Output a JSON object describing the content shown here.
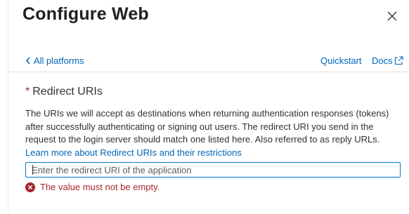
{
  "header": {
    "title": "Configure Web",
    "close_icon": "close-icon"
  },
  "nav": {
    "back_label": "All platforms",
    "back_icon": "chevron-left-icon",
    "quickstart_label": "Quickstart",
    "docs_label": "Docs",
    "docs_icon": "external-link-icon"
  },
  "redirect": {
    "required_marker": "*",
    "heading": "Redirect URIs",
    "description": "The URIs we will accept as destinations when returning authentication responses (tokens) after successfully authenticating or signing out users. The redirect URI you send in the request to the login server should match one listed here. Also referred to as reply URLs.",
    "learn_more": "Learn more about Redirect URIs and their restrictions",
    "input_value": "",
    "input_placeholder": "Enter the redirect URI of the application",
    "error_icon": "error-circle-icon",
    "error_message": "The value must not be empty."
  },
  "colors": {
    "link": "#0066b8",
    "error": "#a4262c",
    "input_border": "#0078d4",
    "text": "#323130"
  }
}
